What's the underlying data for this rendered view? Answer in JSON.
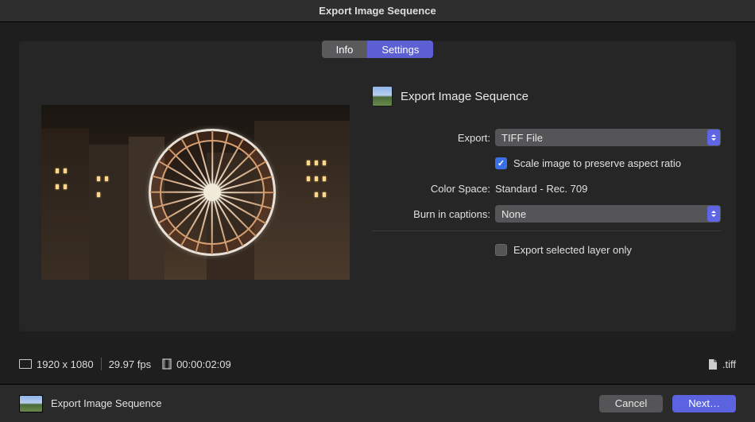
{
  "window": {
    "title": "Export Image Sequence"
  },
  "tabs": {
    "info": "Info",
    "settings": "Settings"
  },
  "header": {
    "title": "Export Image Sequence"
  },
  "form": {
    "export_label": "Export:",
    "export_value": "TIFF File",
    "scale_checkbox": "Scale image to preserve aspect ratio",
    "color_space_label": "Color Space:",
    "color_space_value": "Standard - Rec. 709",
    "burn_label": "Burn in captions:",
    "burn_value": "None",
    "export_layer_checkbox": "Export selected layer only"
  },
  "status": {
    "resolution": "1920 x 1080",
    "fps": "29.97 fps",
    "timecode": "00:00:02:09",
    "extension": ".tiff"
  },
  "footer": {
    "title": "Export Image Sequence",
    "cancel": "Cancel",
    "next": "Next…"
  }
}
